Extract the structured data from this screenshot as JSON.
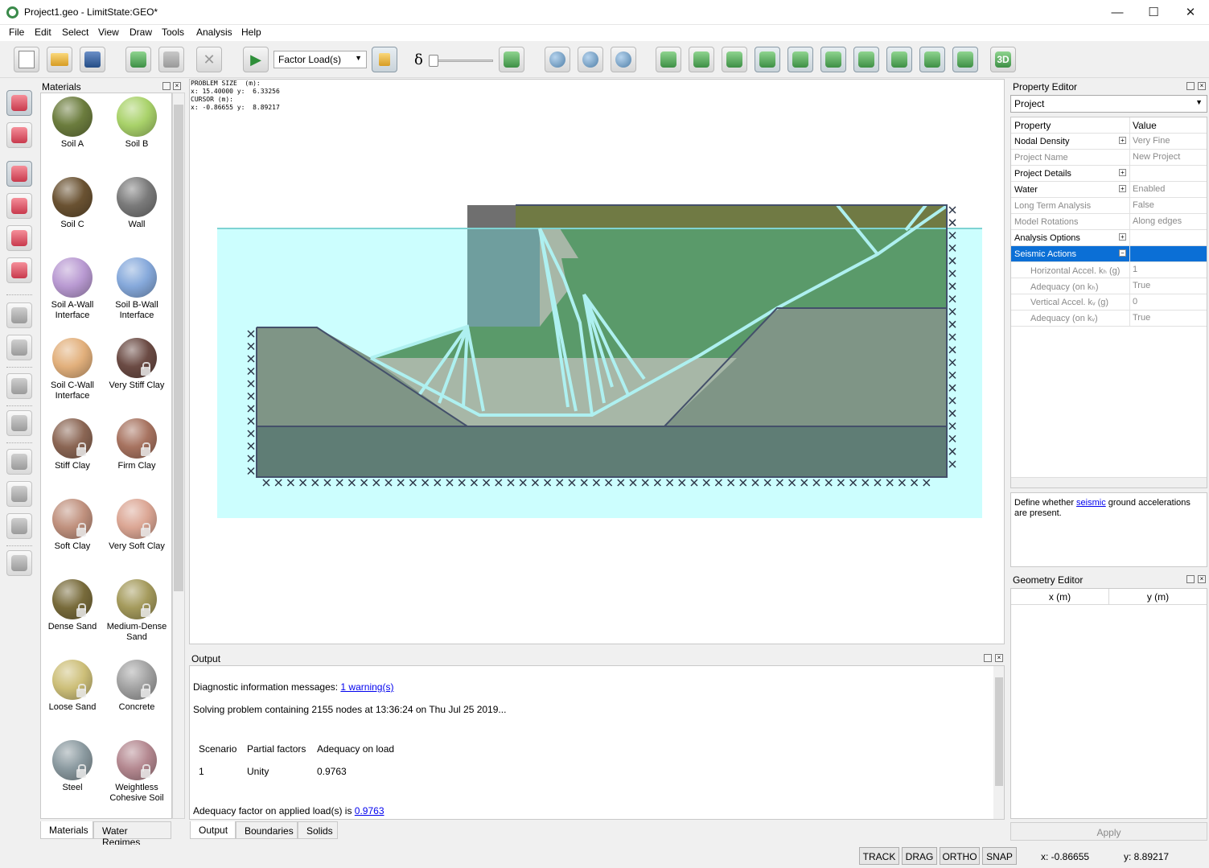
{
  "window": {
    "title": "Project1.geo - LimitState:GEO*",
    "minimize": "—",
    "maximize": "☐",
    "close": "✕"
  },
  "menu": [
    "File",
    "Edit",
    "Select",
    "View",
    "Draw",
    "Tools",
    "Analysis",
    "Help"
  ],
  "toolbar": {
    "load_mode": "Factor Load(s)",
    "delta_symbol": "δ",
    "view3d_label": "3D"
  },
  "materials": {
    "title": "Materials",
    "items": [
      {
        "label": "Soil A",
        "color": "#6c7d3e",
        "locked": false
      },
      {
        "label": "Soil B",
        "color": "#a9d26a",
        "locked": false
      },
      {
        "label": "Soil C",
        "color": "#6a5232",
        "locked": false
      },
      {
        "label": "Wall",
        "color": "#7a7a7a",
        "locked": false
      },
      {
        "label": "Soil A-Wall Interface",
        "color": "#b99ad2",
        "locked": false
      },
      {
        "label": "Soil B-Wall Interface",
        "color": "#86a9db",
        "locked": false
      },
      {
        "label": "Soil C-Wall Interface",
        "color": "#e2b07c",
        "locked": false
      },
      {
        "label": "Very Stiff Clay",
        "color": "#6b4b44",
        "locked": true
      },
      {
        "label": "Stiff Clay",
        "color": "#8b6654",
        "locked": true
      },
      {
        "label": "Firm Clay",
        "color": "#a77360",
        "locked": true
      },
      {
        "label": "Soft Clay",
        "color": "#c0917e",
        "locked": true
      },
      {
        "label": "Very Soft Clay",
        "color": "#dba694",
        "locked": true
      },
      {
        "label": "Dense Sand",
        "color": "#786b3b",
        "locked": true
      },
      {
        "label": "Medium-Dense Sand",
        "color": "#a49a5c",
        "locked": true
      },
      {
        "label": "Loose Sand",
        "color": "#cdbf79",
        "locked": true
      },
      {
        "label": "Concrete",
        "color": "#a2a2a2",
        "locked": true
      },
      {
        "label": "Steel",
        "color": "#8b9aa0",
        "locked": true
      },
      {
        "label": "Weightless Cohesive Soil",
        "color": "#b48890",
        "locked": true
      }
    ],
    "tabs": [
      "Materials",
      "Water Regimes"
    ]
  },
  "canvas": {
    "readout": "PROBLEM SIZE  (m):\nx: 15.40000 y:  6.33256\nCURSOR (m):\nx: -0.86655 y:  8.89217"
  },
  "output": {
    "title": "Output",
    "diag_prefix": "Diagnostic information messages: ",
    "diag_link": "1 warning(s)",
    "solving": "Solving problem containing 2155 nodes at 13:36:24 on Thu Jul 25 2019...",
    "table_headers": [
      "Scenario",
      "Partial factors",
      "Adequacy on load"
    ],
    "table_row": [
      "1",
      "Unity",
      "0.9763"
    ],
    "adequacy_prefix": "Adequacy factor on applied load(s) is ",
    "adequacy_link": "0.9763",
    "tabs": [
      "Output",
      "Boundaries",
      "Solids"
    ]
  },
  "property_editor": {
    "title": "Property Editor",
    "selected": "Project",
    "header": [
      "Property",
      "Value"
    ],
    "rows": [
      {
        "key": "Nodal Density",
        "value": "Very Fine"
      },
      {
        "key": "Project Name",
        "value": "New Project"
      },
      {
        "key": "Project Details",
        "value": ""
      },
      {
        "key": "Water",
        "value": "Enabled"
      },
      {
        "key": "Long Term Analysis",
        "value": "False"
      },
      {
        "key": "Model Rotations",
        "value": "Along edges"
      },
      {
        "key": "Analysis Options",
        "value": ""
      },
      {
        "key": "Seismic Actions",
        "value": ""
      },
      {
        "key": "Horizontal Accel. kₕ (g)",
        "value": "1"
      },
      {
        "key": "Adequacy (on kₕ)",
        "value": "True"
      },
      {
        "key": "Vertical Accel. kᵥ (g)",
        "value": "0"
      },
      {
        "key": "Adequacy (on kᵥ)",
        "value": "True"
      }
    ],
    "desc_prefix": "Define whether ",
    "desc_link": "seismic",
    "desc_suffix": " ground accelerations are present."
  },
  "geometry_editor": {
    "title": "Geometry Editor",
    "headers": [
      "x (m)",
      "y (m)"
    ]
  },
  "apply_label": "Apply",
  "status": {
    "buttons": [
      "TRACK",
      "DRAG",
      "ORTHO",
      "SNAP"
    ],
    "x": "x: -0.86655",
    "y": "y: 8.89217"
  },
  "colors": {
    "water": "#ccfefe",
    "soil_top": "#707a44",
    "soil_green": "#5a9a6a",
    "soil_gray": "#7f9586",
    "soil_bottom": "#5f7d75",
    "wall": "#6f9e9e",
    "mechanism": "#aef0f0",
    "selection": "#0b6fd6"
  }
}
